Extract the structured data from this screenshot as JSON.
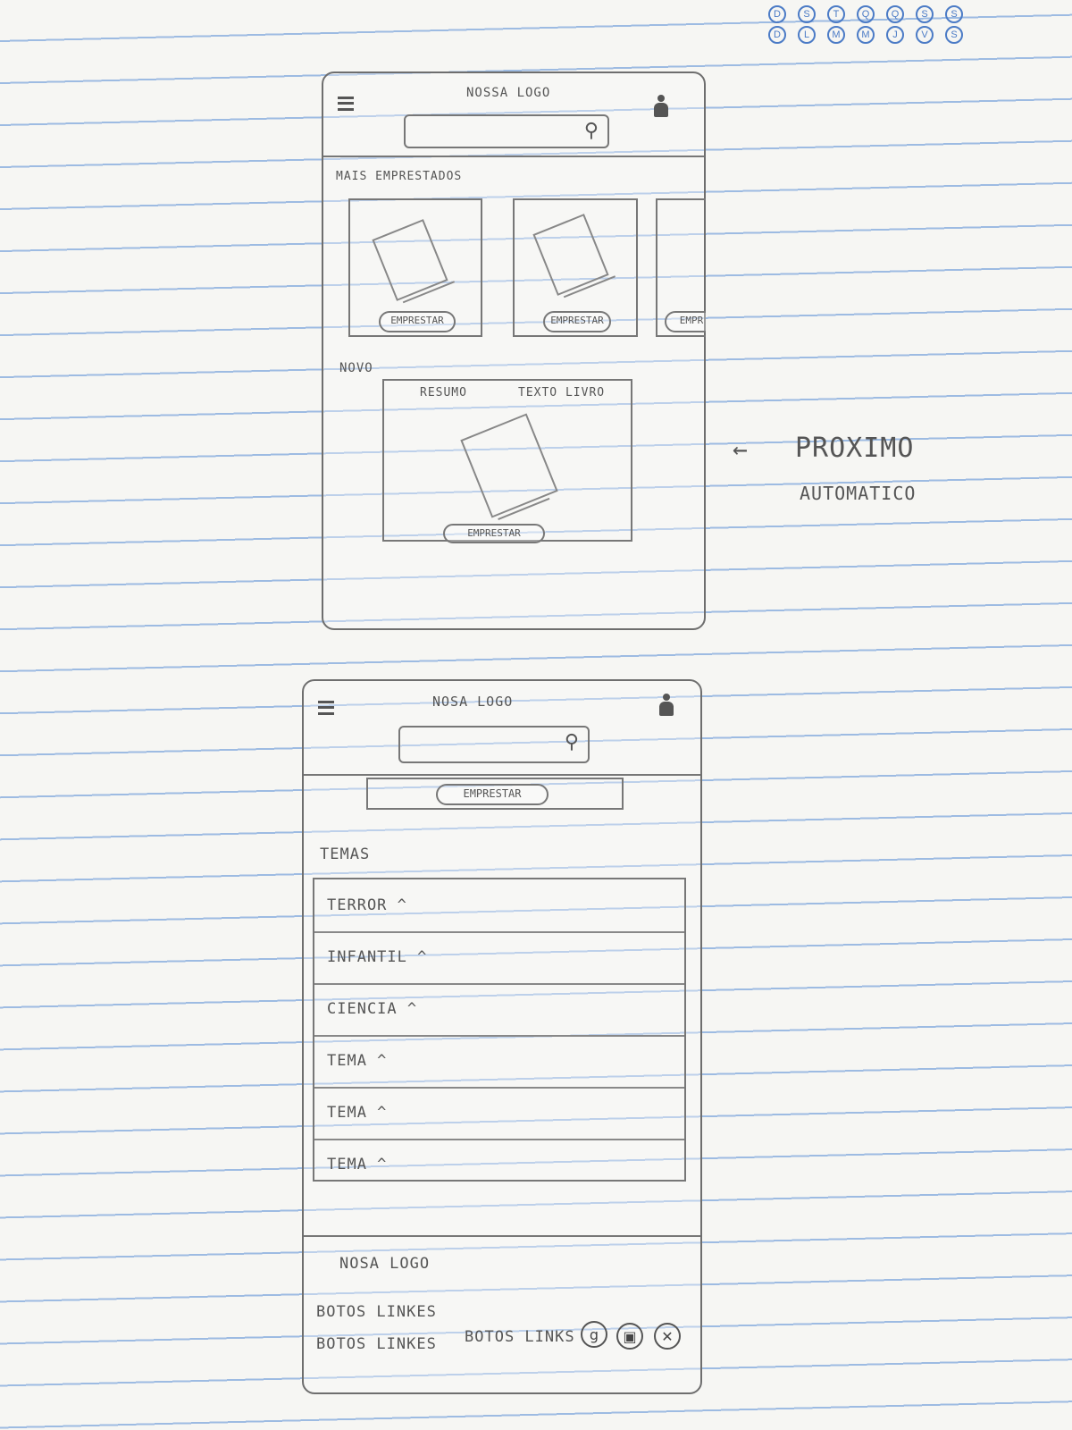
{
  "calendar_days": {
    "top": [
      "D",
      "S",
      "T",
      "Q",
      "Q",
      "S",
      "S"
    ],
    "bottom": [
      "D",
      "L",
      "M",
      "M",
      "J",
      "V",
      "S"
    ]
  },
  "screen1": {
    "logo": "NOSSA LOGO",
    "search_icon": "magnifier-icon",
    "section_title": "MAIS EMPRESTADOS",
    "cards": [
      {
        "button": "EMPRESTAR"
      },
      {
        "button": "EMPRESTAR"
      },
      {
        "button": "EMPR"
      }
    ],
    "new_section_title": "NOVO",
    "tabs": [
      "RESUMO",
      "TEXTO LIVRO"
    ],
    "featured_button": "EMPRESTAR"
  },
  "annotation": {
    "arrow": "←",
    "line1": "PROXIMO",
    "line2": "AUTOMATICO"
  },
  "screen2": {
    "logo": "NOSA LOGO",
    "borrow_button": "EMPRESTAR",
    "themes_title": "TEMAS",
    "themes": [
      "TERROR ^",
      "INFANTIL ^",
      "CIENCIA ^",
      "TEMA ^",
      "TEMA ^",
      "TEMA ^"
    ],
    "footer": {
      "logo": "NOSA LOGO",
      "links_line1": "BOTOS LINKES",
      "links_line2a": "BOTOS LINKES",
      "links_line2b": "BOTOS LINKS",
      "social_icons": [
        "g",
        "▣",
        "✕"
      ]
    }
  }
}
